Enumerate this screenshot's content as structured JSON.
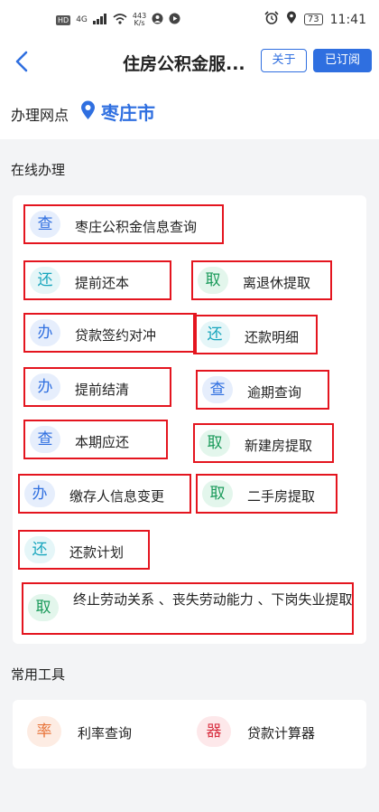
{
  "status_bar": {
    "hd_label": "HD",
    "network": "4G",
    "speed_value": "443",
    "speed_unit": "K/s",
    "battery": "73",
    "time": "11:41"
  },
  "nav": {
    "back_glyph": "<",
    "title": "住房公积金服...",
    "about_label": "关于",
    "subscribed_label": "已订阅"
  },
  "location": {
    "label": "办理网点",
    "city": "枣庄市",
    "icon": "location-pin-icon"
  },
  "online": {
    "title": "在线办理",
    "items": [
      {
        "icon_char": "查",
        "label": "枣庄公积金信息查询"
      },
      {
        "icon_char": "还",
        "label": "提前还本"
      },
      {
        "icon_char": "取",
        "label": "离退休提取"
      },
      {
        "icon_char": "办",
        "label": "贷款签约对冲"
      },
      {
        "icon_char": "还",
        "label": "还款明细"
      },
      {
        "icon_char": "办",
        "label": "提前结清"
      },
      {
        "icon_char": "查",
        "label": "逾期查询"
      },
      {
        "icon_char": "查",
        "label": "本期应还"
      },
      {
        "icon_char": "取",
        "label": "新建房提取"
      },
      {
        "icon_char": "办",
        "label": "缴存人信息变更"
      },
      {
        "icon_char": "取",
        "label": "二手房提取"
      },
      {
        "icon_char": "还",
        "label": "还款计划"
      },
      {
        "icon_char": "取",
        "label": "终止劳动关系 、丧失劳动能力 、下岗失业提取"
      }
    ]
  },
  "tools": {
    "title": "常用工具",
    "items": [
      {
        "icon_char": "率",
        "label": "利率查询"
      },
      {
        "icon_char": "器",
        "label": "贷款计算器"
      }
    ]
  },
  "colors": {
    "accent": "#2f6fe0",
    "highlight_border": "#e4151f"
  }
}
